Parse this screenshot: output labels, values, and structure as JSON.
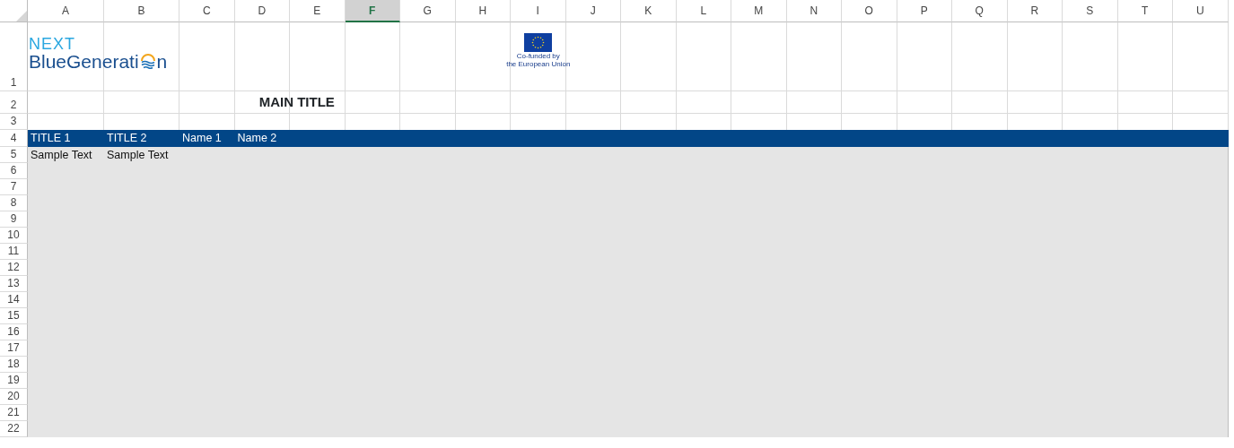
{
  "columns": [
    {
      "label": "A",
      "selected": false
    },
    {
      "label": "B",
      "selected": false
    },
    {
      "label": "C",
      "selected": false
    },
    {
      "label": "D",
      "selected": false
    },
    {
      "label": "E",
      "selected": false
    },
    {
      "label": "F",
      "selected": true
    },
    {
      "label": "G",
      "selected": false
    },
    {
      "label": "H",
      "selected": false
    },
    {
      "label": "I",
      "selected": false
    },
    {
      "label": "J",
      "selected": false
    },
    {
      "label": "K",
      "selected": false
    },
    {
      "label": "L",
      "selected": false
    },
    {
      "label": "M",
      "selected": false
    },
    {
      "label": "N",
      "selected": false
    },
    {
      "label": "O",
      "selected": false
    },
    {
      "label": "P",
      "selected": false
    },
    {
      "label": "Q",
      "selected": false
    },
    {
      "label": "R",
      "selected": false
    },
    {
      "label": "S",
      "selected": false
    },
    {
      "label": "T",
      "selected": false
    },
    {
      "label": "U",
      "selected": false
    }
  ],
  "row_numbers": [
    "1",
    "2",
    "3",
    "4",
    "5",
    "6",
    "7",
    "8",
    "9",
    "10",
    "11",
    "12",
    "13",
    "14",
    "15",
    "16",
    "17",
    "18",
    "19",
    "20",
    "21",
    "22"
  ],
  "logo": {
    "line_1": "NEXT",
    "line_2_start": "BlueGenerati",
    "line_2_end": "n"
  },
  "eu_emblem": {
    "caption_1": "Co-funded by",
    "caption_2": "the European Union"
  },
  "main_title": "MAIN TITLE",
  "header_row": [
    "TITLE 1",
    "TITLE 2",
    "Name 1",
    "Name 2"
  ],
  "data_rows": [
    [
      "Sample Text",
      "Sample Text"
    ]
  ]
}
